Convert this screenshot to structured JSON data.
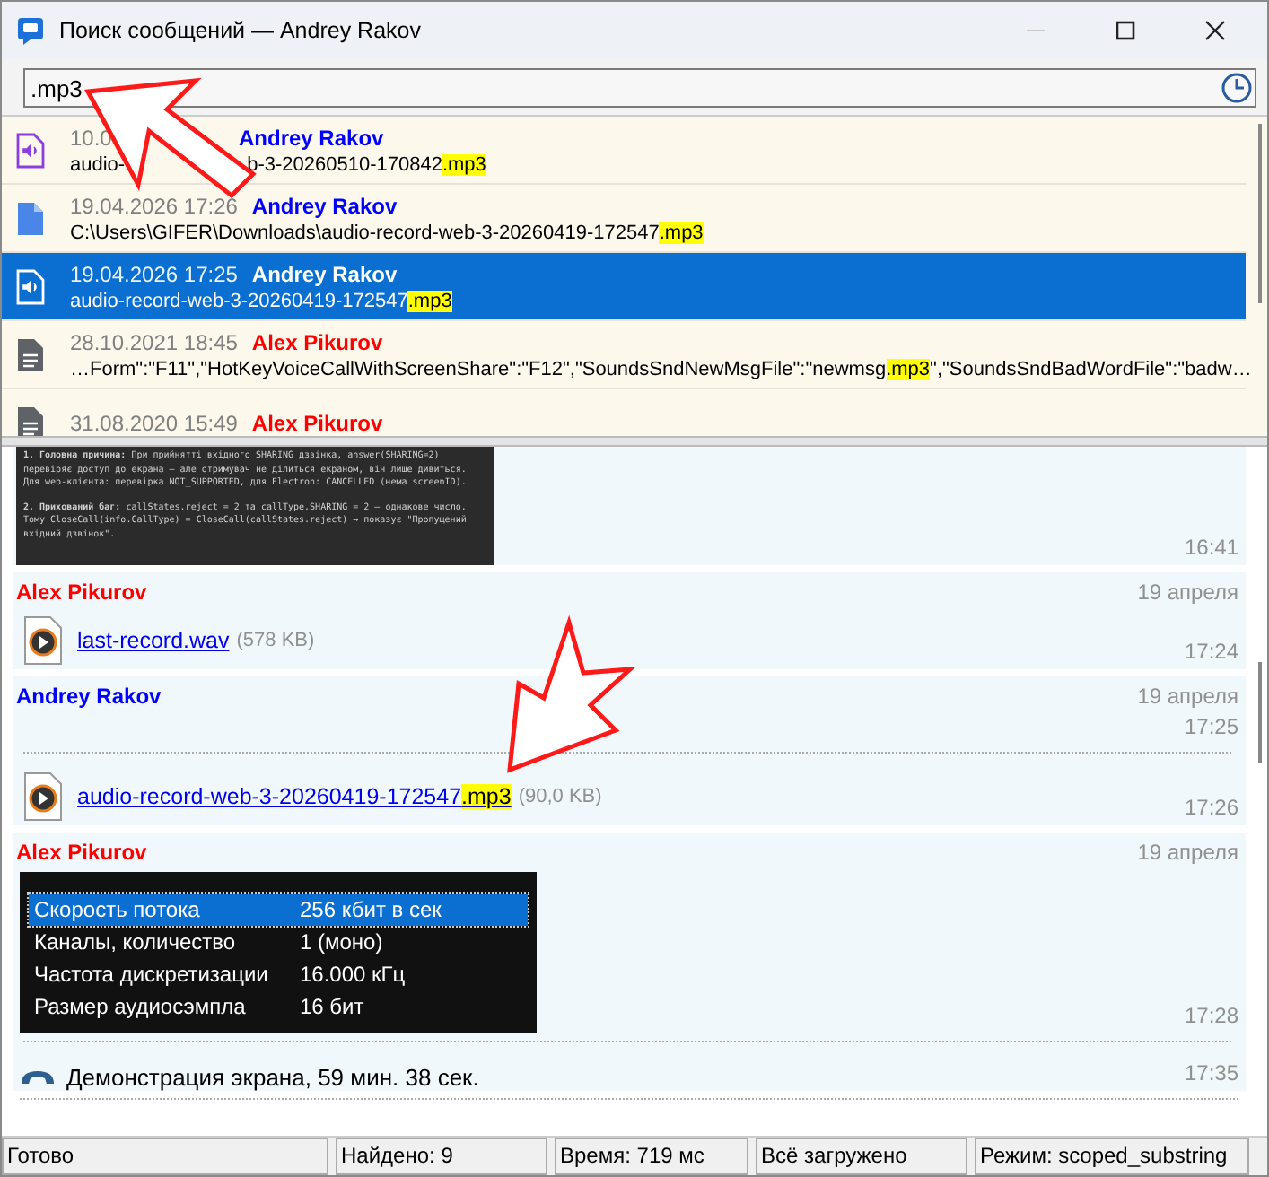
{
  "window": {
    "title": "Поиск сообщений — Andrey Rakov"
  },
  "search": {
    "value": ".mp3"
  },
  "results": [
    {
      "kind": "audio",
      "date": "10.0",
      "author": "Andrey Rakov",
      "color": "#0000ff",
      "text": "audio-",
      "selected": false,
      "tail": "b-3-20260510-170842",
      "tail_match": ".mp3"
    },
    {
      "kind": "file",
      "date": "19.04.2026 17:26",
      "author": "Andrey Rakov",
      "color": "#0000ff",
      "text": "C:\\Users\\GIFER\\Downloads\\audio-record-web-3-20260419-172547",
      "match": ".mp3",
      "selected": false
    },
    {
      "kind": "audio",
      "date": "19.04.2026 17:25",
      "author": "Andrey Rakov",
      "text": "audio-record-web-3-20260419-172547",
      "match": ".mp3",
      "selected": true
    },
    {
      "kind": "doc",
      "date": "28.10.2021 18:45",
      "author": "Alex Pikurov",
      "color": "#ff0000",
      "text": "…Form\":\"F11\",\"HotKeyVoiceCallWithScreenShare\":\"F12\",\"SoundsSndNewMsgFile\":\"newmsg",
      "match": ".mp3",
      "rest": "\",\"SoundsSndBadWordFile\":\"badw…",
      "selected": false
    },
    {
      "kind": "doc",
      "date": "31.08.2020 15:49",
      "author": "Alex Pikurov",
      "color": "#ff0000",
      "selected": false
    }
  ],
  "messages": [
    {
      "parts": [
        {
          "kind": "code_image",
          "lines": [
            "**1. Головна причина:** При прийнятті вхідного SHARING дзвінка, answer(SHARING=2)",
            "перевіряє доступ до екрана — але отримувач не ділиться екраном, він лише дивиться.",
            "Для web-клієнта: перевірка NOT_SUPPORTED, для Electron: CANCELLED (нема screenID).",
            "**2. Прихований баг:** callStates.reject = 2 та callType.SHARING = 2 — однакове число.",
            "Тому CloseCall(info.CallType) = CloseCall(callStates.reject) → показує \"Пропущений",
            "вхідний дзвінок\"."
          ],
          "time": "16:41"
        }
      ]
    },
    {
      "sender": "Alex Pikurov",
      "color": "#ff0000",
      "date": "19 апреля",
      "parts": [
        {
          "kind": "file",
          "name": "last-record",
          "match": ".wav",
          "highlight": false,
          "size": "(578 KB)",
          "time": "17:24"
        }
      ]
    },
    {
      "sender": "Andrey Rakov",
      "color": "#0000ff",
      "date": "19 апреля",
      "parts": [
        {
          "kind": "empty",
          "time": "17:25"
        },
        {
          "kind": "file",
          "name": "audio-record-web-3-20260419-172547",
          "match": ".mp3",
          "highlight": true,
          "size": "(90,0 KB)",
          "time": "17:26"
        }
      ]
    },
    {
      "sender": "Alex Pikurov",
      "color": "#ff0000",
      "date": "19 апреля",
      "parts": [
        {
          "kind": "table_image",
          "rows": [
            {
              "label": "Скорость потока",
              "value": "256 кбит в сек",
              "selected": true
            },
            {
              "label": "Каналы, количество",
              "value": "1 (моно)",
              "selected": false
            },
            {
              "label": "Частота дискретизации",
              "value": "16.000 кГц",
              "selected": false
            },
            {
              "label": "Размер аудиосэмпла",
              "value": "16 бит",
              "selected": false
            }
          ],
          "time": "17:28"
        },
        {
          "kind": "call",
          "text": "Демонстрация экрана, 59 мин. 38 сек.",
          "time": "17:35"
        }
      ]
    }
  ],
  "status_bar": [
    "Готово",
    "Найдено: 9",
    "Время: 719 мс",
    "Всё загружено",
    "Режим: scoped_substring"
  ]
}
